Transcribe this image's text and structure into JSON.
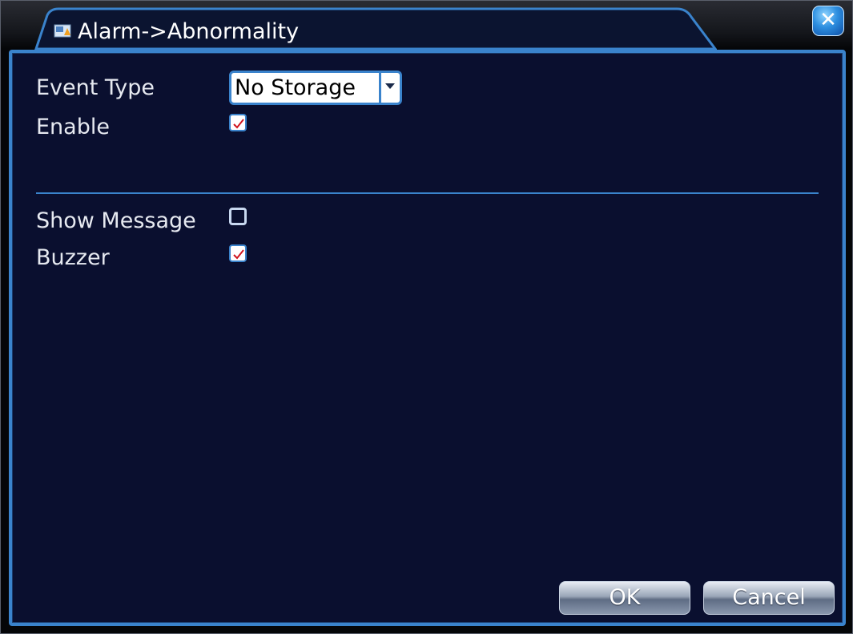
{
  "window": {
    "title": "Alarm->Abnormality",
    "title_icon": "alarm-window-icon",
    "close_icon": "close-icon",
    "close_label": "✕"
  },
  "form": {
    "event_type": {
      "label": "Event Type",
      "selected": "No Storage"
    },
    "enable": {
      "label": "Enable",
      "checked": true
    },
    "show_message": {
      "label": "Show Message",
      "checked": false
    },
    "buzzer": {
      "label": "Buzzer",
      "checked": true
    }
  },
  "buttons": {
    "ok": "OK",
    "cancel": "Cancel"
  },
  "colors": {
    "accent": "#3a83cc",
    "panel_bg": "#0a0f2f",
    "check_mark": "#d0141e"
  }
}
